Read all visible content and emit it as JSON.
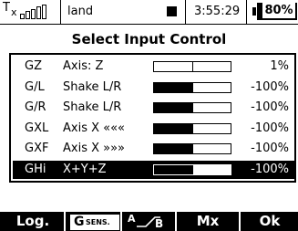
{
  "status_bar": {
    "tx_label": "T",
    "tx_sub": "x",
    "signal_bars": [
      0.2,
      0.4,
      0.6,
      0.8,
      1.0
    ],
    "model_name": "land",
    "clock": "3:55:29",
    "battery": "80%"
  },
  "title": "Select Input Control",
  "rows": [
    {
      "code": "GZ",
      "name": "Axis: Z",
      "level": 0.0,
      "value": "1%"
    },
    {
      "code": "G/L",
      "name": "Shake L/R",
      "level": 0.5,
      "value": "-100%"
    },
    {
      "code": "G/R",
      "name": "Shake L/R",
      "level": 0.5,
      "value": "-100%"
    },
    {
      "code": "GXL",
      "name": "Axis X «««",
      "level": 0.5,
      "value": "-100%"
    },
    {
      "code": "GXF",
      "name": "Axis X »»»",
      "level": 0.5,
      "value": "-100%"
    },
    {
      "code": "GHi",
      "name": "X+Y+Z",
      "level": 0.5,
      "value": "-100%",
      "selected": true
    }
  ],
  "softkeys": {
    "log": "Log.",
    "gsens_main": "G",
    "gsens_sub": "SENS.",
    "ab_a": "A",
    "ab_b": "B",
    "mx": "Mx",
    "ok": "Ok"
  }
}
